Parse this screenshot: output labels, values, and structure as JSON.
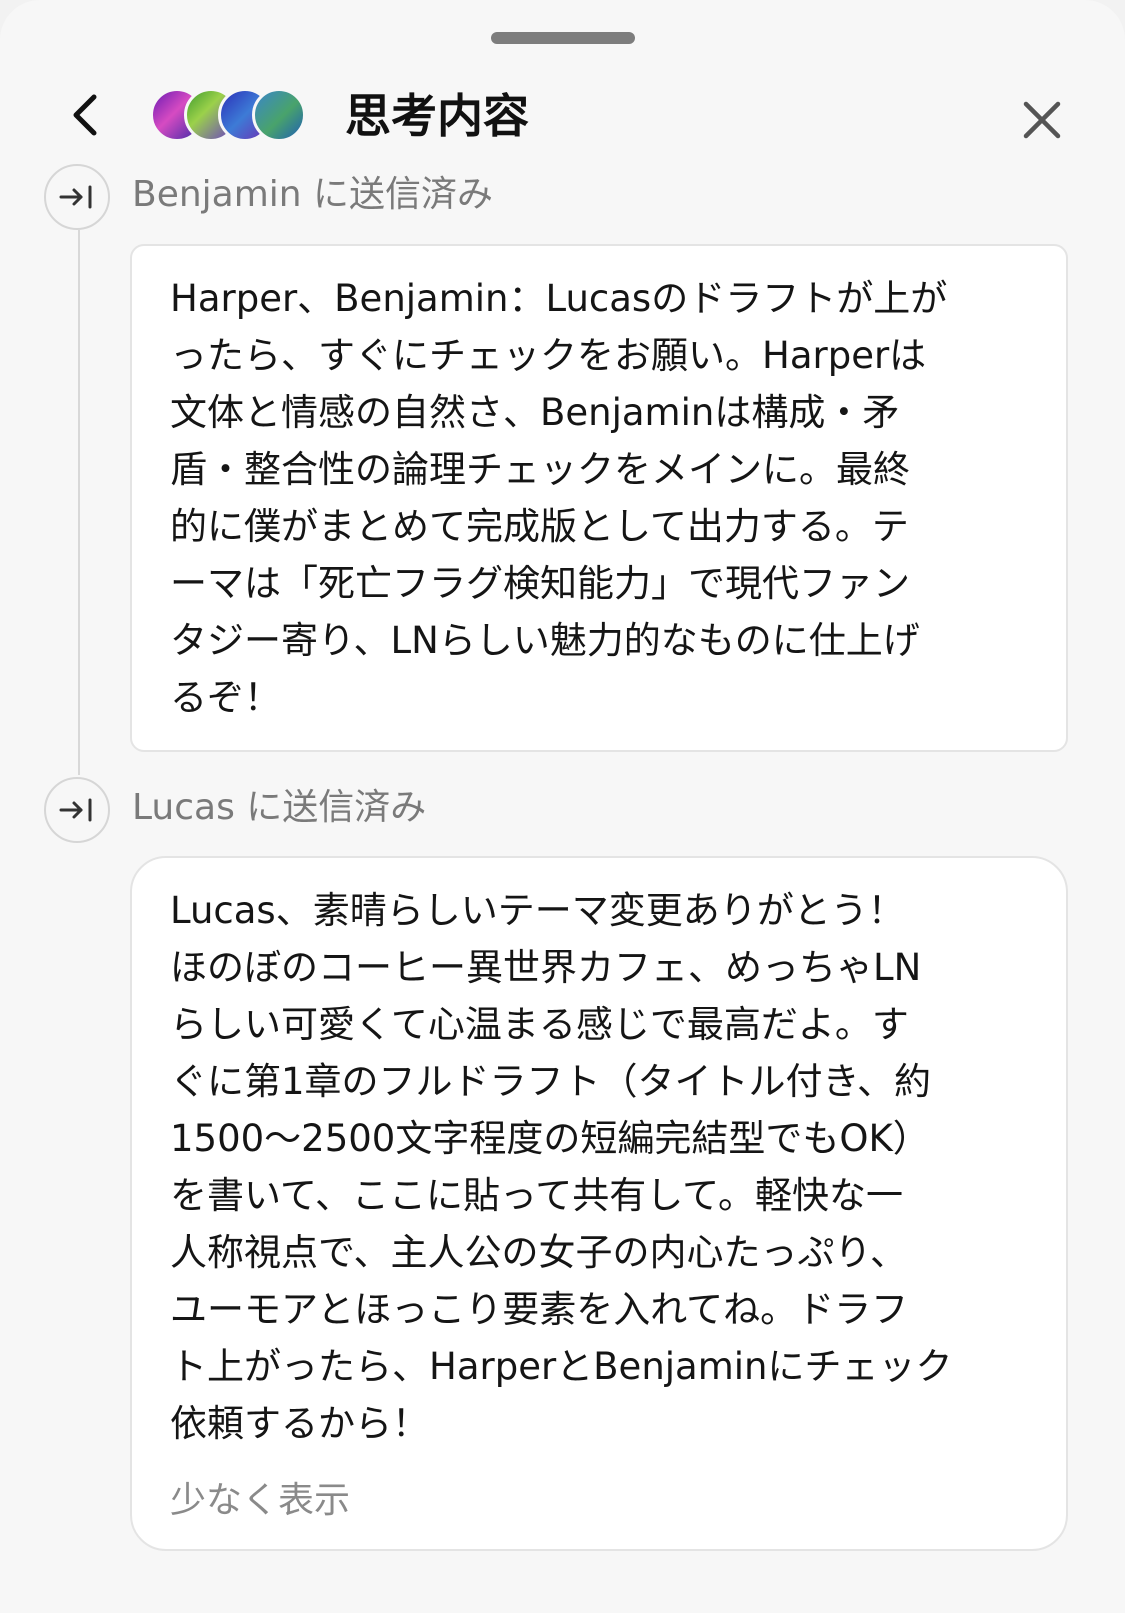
{
  "header": {
    "title": "思考内容",
    "back_icon": "chevron-left-icon",
    "close_icon": "close-icon"
  },
  "participants": [
    {
      "avatar": "participant-avatar-1"
    },
    {
      "avatar": "participant-avatar-2"
    },
    {
      "avatar": "participant-avatar-3"
    },
    {
      "avatar": "participant-avatar-4"
    }
  ],
  "steps": [
    {
      "label": "Benjamin に送信済み",
      "icon": "send-arrow-icon",
      "message": "Harper、Benjamin：Lucasのドラフトが上が\nったら、すぐにチェックをお願い。Harperは\n文体と情感の自然さ、Benjaminは構成・矛\n盾・整合性の論理チェックをメインに。最終\n的に僕がまとめて完成版として出力する。テ\nーマは「死亡フラグ検知能力」で現代ファン\nタジー寄り、LNらしい魅力的なものに仕上げ\nるぞ！"
    },
    {
      "label": "Lucas に送信済み",
      "icon": "send-arrow-icon",
      "message": "Lucas、素晴らしいテーマ変更ありがとう！\nほのぼのコーヒー異世界カフェ、めっちゃLN\nらしい可愛くて心温まる感じで最高だよ。す\nぐに第1章のフルドラフト（タイトル付き、約\n1500〜2500文字程度の短編完結型でもOK）\nを書いて、ここに貼って共有して。軽快な一\n人称視点で、主人公の女子の内心たっぷり、\nユーモアとほっこり要素を入れてね。ドラフ\nト上がったら、HarperとBenjaminにチェック\n依頼するから！",
      "collapse_label": "少なく表示"
    }
  ]
}
